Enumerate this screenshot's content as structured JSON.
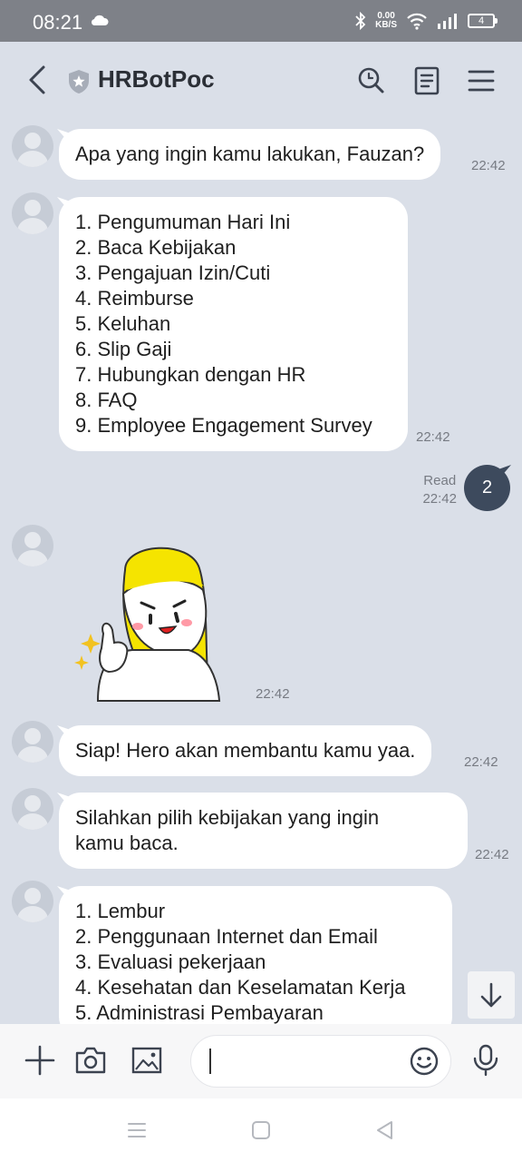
{
  "status_bar": {
    "time": "08:21",
    "net_speed_value": "0.00",
    "net_speed_unit": "KB/S",
    "battery": "4"
  },
  "header": {
    "title": "HRBotPoc",
    "icons": [
      "back-icon",
      "shield-icon",
      "search-icon",
      "notes-icon",
      "menu-icon"
    ]
  },
  "messages": [
    {
      "sender": "bot",
      "lines": [
        "Apa yang ingin kamu lakukan, Fauzan?"
      ],
      "time": "22:42"
    },
    {
      "sender": "bot",
      "lines": [
        "1. Pengumuman Hari Ini",
        "2. Baca Kebijakan",
        "3. Pengajuan Izin/Cuti",
        "4. Reimburse",
        "5. Keluhan",
        "6. Slip Gaji",
        "7. Hubungkan dengan HR",
        "8. FAQ",
        "9. Employee Engagement Survey"
      ],
      "time": "22:42"
    },
    {
      "sender": "user",
      "text": "2",
      "status": "Read",
      "time": "22:42"
    },
    {
      "sender": "bot",
      "type": "sticker",
      "time": "22:42"
    },
    {
      "sender": "bot",
      "lines": [
        "Siap! Hero akan membantu kamu yaa."
      ],
      "time": "22:42"
    },
    {
      "sender": "bot",
      "lines": [
        "Silahkan pilih kebijakan yang ingin",
        "kamu baca."
      ],
      "time": "22:42"
    },
    {
      "sender": "bot",
      "lines": [
        "1. Lembur",
        "2. Penggunaan Internet dan Email",
        "3. Evaluasi pekerjaan",
        "4. Kesehatan dan Keselamatan Kerja",
        "5. Administrasi Pembayaran"
      ]
    }
  ],
  "input_bar": {
    "placeholder": "",
    "icons": [
      "plus-icon",
      "camera-icon",
      "image-icon",
      "emoji-icon",
      "mic-icon"
    ]
  },
  "colors": {
    "background": "#dadfe8",
    "user_bubble": "#3d4a5d",
    "status_bar": "#7e8188"
  }
}
